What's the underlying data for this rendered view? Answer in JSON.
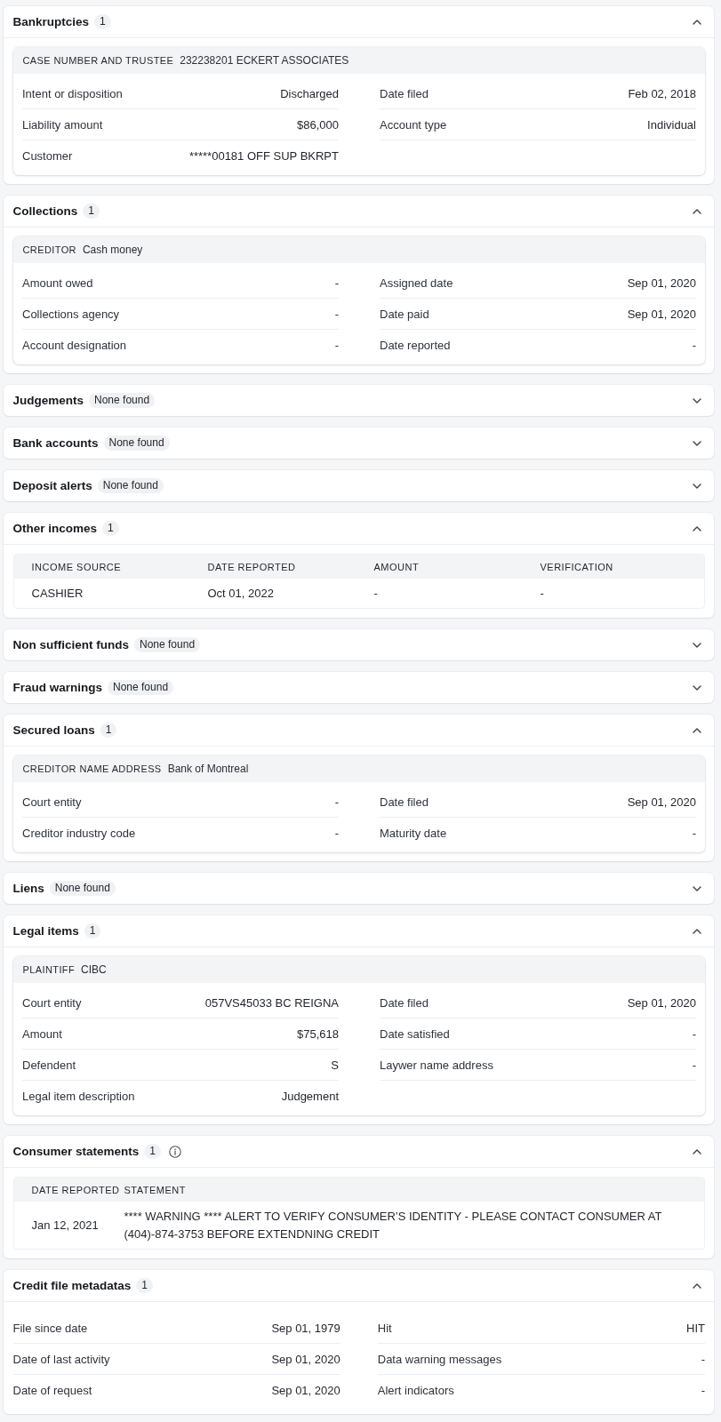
{
  "sections": [
    {
      "title": "Bankruptcies",
      "badge": "1",
      "expanded": true,
      "body": {
        "kind": "record",
        "heading_label": "CASE NUMBER AND TRUSTEE",
        "heading_value": "232238201 ECKERT ASSOCIATES",
        "left": [
          {
            "label": "Intent or disposition",
            "value": "Discharged"
          },
          {
            "label": "Liability amount",
            "value": "$86,000"
          },
          {
            "label": "Customer",
            "value": "*****00181 OFF SUP BKRPT"
          }
        ],
        "right": [
          {
            "label": "Date filed",
            "value": "Feb 02, 2018"
          },
          {
            "label": "Account type",
            "value": "Individual"
          }
        ]
      }
    },
    {
      "title": "Collections",
      "badge": "1",
      "expanded": true,
      "body": {
        "kind": "record",
        "heading_label": "CREDITOR",
        "heading_value": "Cash money",
        "left": [
          {
            "label": "Amount owed",
            "value": "-"
          },
          {
            "label": "Collections agency",
            "value": "-"
          },
          {
            "label": "Account designation",
            "value": "-"
          }
        ],
        "right": [
          {
            "label": "Assigned date",
            "value": "Sep 01, 2020"
          },
          {
            "label": "Date paid",
            "value": "Sep 01, 2020"
          },
          {
            "label": "Date reported",
            "value": "-"
          }
        ]
      }
    },
    {
      "title": "Judgements",
      "badge": "None found",
      "expanded": false
    },
    {
      "title": "Bank accounts",
      "badge": "None found",
      "expanded": false
    },
    {
      "title": "Deposit alerts",
      "badge": "None found",
      "expanded": false
    },
    {
      "title": "Other incomes",
      "badge": "1",
      "expanded": true,
      "body": {
        "kind": "table",
        "columns": [
          "INCOME SOURCE",
          "DATE REPORTED",
          "AMOUNT",
          "VERIFICATION"
        ],
        "rows": [
          [
            "CASHIER",
            "Oct 01, 2022",
            "-",
            "-"
          ]
        ]
      }
    },
    {
      "title": "Non sufficient funds",
      "badge": "None found",
      "expanded": false
    },
    {
      "title": "Fraud warnings",
      "badge": "None found",
      "expanded": false
    },
    {
      "title": "Secured loans",
      "badge": "1",
      "expanded": true,
      "body": {
        "kind": "record",
        "heading_label": "CREDITOR NAME ADDRESS",
        "heading_value": "Bank of Montreal",
        "left": [
          {
            "label": "Court entity",
            "value": "-"
          },
          {
            "label": "Creditor industry code",
            "value": "-"
          }
        ],
        "right": [
          {
            "label": "Date filed",
            "value": "Sep 01, 2020"
          },
          {
            "label": "Maturity date",
            "value": "-"
          }
        ]
      }
    },
    {
      "title": "Liens",
      "badge": "None found",
      "expanded": false
    },
    {
      "title": "Legal items",
      "badge": "1",
      "expanded": true,
      "body": {
        "kind": "record",
        "heading_label": "PLAINTIFF",
        "heading_value": "CIBC",
        "left": [
          {
            "label": "Court entity",
            "value": "057VS45033 BC REIGNA"
          },
          {
            "label": "Amount",
            "value": "$75,618"
          },
          {
            "label": "Defendent",
            "value": "S"
          },
          {
            "label": "Legal item description",
            "value": "Judgement"
          }
        ],
        "right": [
          {
            "label": "Date filed",
            "value": "Sep 01, 2020"
          },
          {
            "label": "Date satisfied",
            "value": "-"
          },
          {
            "label": "Laywer name address",
            "value": "-"
          }
        ]
      }
    },
    {
      "title": "Consumer statements",
      "badge": "1",
      "info_icon": true,
      "expanded": true,
      "body": {
        "kind": "table",
        "columns": [
          "DATE REPORTED",
          "STATEMENT"
        ],
        "rows": [
          [
            "Jan 12, 2021",
            "**** WARNING **** ALERT TO VERIFY CONSUMER’S IDENTITY - PLEASE CONTACT CONSUMER AT (404)-874-3753 BEFORE EXTENDNING CREDIT"
          ]
        ]
      }
    },
    {
      "title": "Credit file metadatas",
      "badge": "1",
      "expanded": true,
      "body": {
        "kind": "fields",
        "left": [
          {
            "label": "File since date",
            "value": "Sep 01, 1979"
          },
          {
            "label": "Date of last activity",
            "value": "Sep 01, 2020"
          },
          {
            "label": "Date of request",
            "value": "Sep 01, 2020"
          }
        ],
        "right": [
          {
            "label": "Hit",
            "value": "HIT"
          },
          {
            "label": "Data warning messages",
            "value": "-"
          },
          {
            "label": "Alert indicators",
            "value": "-"
          }
        ]
      }
    }
  ]
}
